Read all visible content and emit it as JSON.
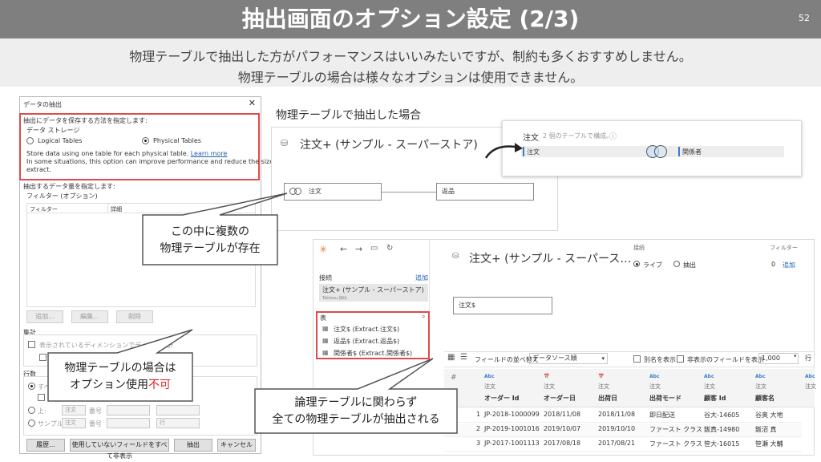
{
  "slide": {
    "title": "抽出画面のオプション設定 (2/3)",
    "page_number": "52",
    "subtitle_line1": "物理テーブルで抽出した方がパフォーマンスはいいみたいですが、制約も多くおすすめしません。",
    "subtitle_line2": "物理テーブルの場合は様々なオプションは使用できません。"
  },
  "dialog": {
    "title": "データの抽出",
    "storage_heading": "抽出にデータを保存する方法を指定します:",
    "storage_group": "データ ストレージ",
    "logical_label": "Logical Tables",
    "physical_label": "Physical Tables",
    "physical_selected": true,
    "desc_line1": "Store data using one table for each physical table.",
    "desc_link": "Learn more",
    "desc_line2": "In some situations, this option can improve performance and reduce the size of your",
    "desc_line3": "extract.",
    "data_heading": "抽出するデータ量を指定します:",
    "filter_group": "フィルター (オプション)",
    "col_filter": "フィルター",
    "col_detail": "詳細",
    "add_btn": "追加...",
    "edit_btn": "編集...",
    "delete_btn": "削除",
    "aggregate_heading": "集計",
    "aggregate_check": "表示されているディメンションでデータを集計",
    "rows_heading": "行数",
    "rows_all": "すべ",
    "rows_top": "上:",
    "rows_sample": "サンプル:",
    "combo_note": "注文",
    "combo_field": "番号",
    "combo_unit": "行",
    "history_btn": "履歴...",
    "hide_fields_btn": "使用していないフィールドをすべて非表示",
    "extract_btn": "抽出",
    "cancel_btn": "キャンセル"
  },
  "callouts": {
    "c1_line1": "この中に複数の",
    "c1_line2": "物理テーブルが存在",
    "c2_line1": "物理テーブルの場合は",
    "c2_line2_pre": "オプション使用",
    "c2_line2_red": "不可",
    "c3_line1": "論理テーブルに関わらず",
    "c3_line2": "全ての物理テーブルが抽出される"
  },
  "upper_panel": {
    "label": "物理テーブルで抽出した場合",
    "ds_name": "注文+ (サンプル - スーパーストア)",
    "node_order": "注文",
    "node_returns": "返品"
  },
  "popup": {
    "name": "注文",
    "hint": "2 個のテーブルで構成。",
    "left_table": "注文",
    "right_table": "関係者"
  },
  "lower_panel": {
    "ds_title": "注文+ (サンプル - スーパース…",
    "connection_label": "接続",
    "live_label": "ライブ",
    "extract_label": "抽出",
    "filter_label": "フィルター",
    "filter_count": "0",
    "filter_add": "追加",
    "conn_heading": "接続",
    "conn_add": "追加",
    "conn_name": "注文+ (サンプル - スーパーストア)",
    "conn_sub": "Tableau 抽出",
    "tables_heading": "表",
    "tables": [
      "注文$ (Extract.注文$)",
      "返品$ (Extract.返品$)",
      "関係者$ (Extract.関係者$)"
    ],
    "canvas_node": "注文$",
    "toolbar_sort_label": "フィールドの並べ替え",
    "toolbar_sort_value": "データソース順",
    "alias_label": "別名を表示",
    "hidden_label": "非表示のフィールドを表示",
    "row_count": "1,000",
    "columns": [
      {
        "type": "Abc",
        "src": "注文",
        "name": "オーダー Id"
      },
      {
        "type": "📅",
        "src": "注文",
        "name": "オーダー日"
      },
      {
        "type": "📅",
        "src": "注文",
        "name": "出荷日"
      },
      {
        "type": "Abc",
        "src": "注文",
        "name": "出荷モード"
      },
      {
        "type": "Abc",
        "src": "注文",
        "name": "顧客 Id"
      },
      {
        "type": "Abc",
        "src": "注文",
        "name": "顧客名"
      },
      {
        "type": "Abc",
        "src": "注文",
        "name": ""
      }
    ],
    "rows": [
      [
        "1",
        "JP-2018-1000099",
        "2018/11/08",
        "2018/11/08",
        "即日配送",
        "谷大-14605",
        "谷奥 大地"
      ],
      [
        "2",
        "JP-2019-1001016",
        "2019/10/07",
        "2019/10/10",
        "ファースト クラス",
        "飯真-14980",
        "飯沼 真"
      ],
      [
        "3",
        "JP-2017-1001113",
        "2017/08/18",
        "2017/08/21",
        "ファースト クラス",
        "笹大-16015",
        "笹瀬 大輔"
      ]
    ]
  }
}
